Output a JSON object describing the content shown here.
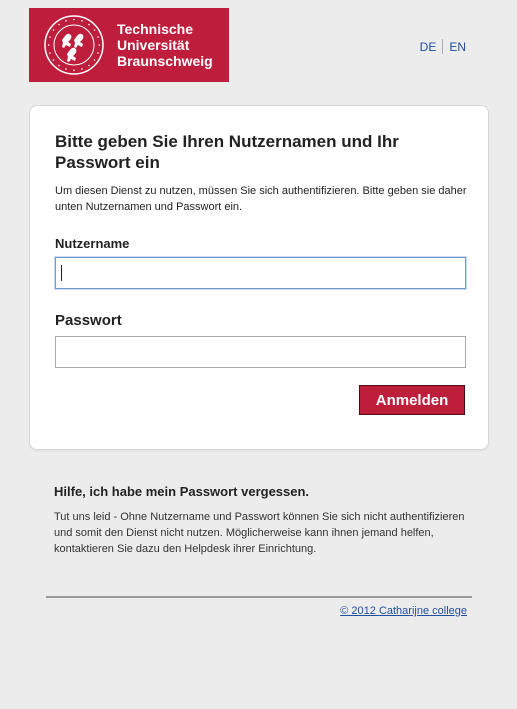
{
  "header": {
    "logo_lines": [
      "Technische",
      "Universität",
      "Braunschweig"
    ],
    "seal_text": "CAROLO-WILHELMINA · BRAUNSCHWEIG",
    "brand_color": "#be1e3c",
    "languages": [
      "DE",
      "EN"
    ]
  },
  "login": {
    "title": "Bitte geben Sie Ihren Nutzernamen und Ihr Passwort ein",
    "intro": "Um diesen Dienst zu nutzen, müssen Sie sich authentifizieren. Bitte geben sie daher unten Nutzernamen und Passwort ein.",
    "username_label": "Nutzername",
    "username_value": "",
    "password_label": "Passwort",
    "password_value": "",
    "submit_label": "Anmelden"
  },
  "help": {
    "title": "Hilfe, ich habe mein Passwort vergessen.",
    "text": "Tut uns leid - Ohne Nutzername und Passwort können Sie sich nicht authentifizieren und somit den Dienst nicht nutzen. Möglicherweise kann ihnen jemand helfen, kontaktieren Sie dazu den Helpdesk ihrer Einrichtung."
  },
  "footer": {
    "link": "© 2012 Catharijne college"
  }
}
